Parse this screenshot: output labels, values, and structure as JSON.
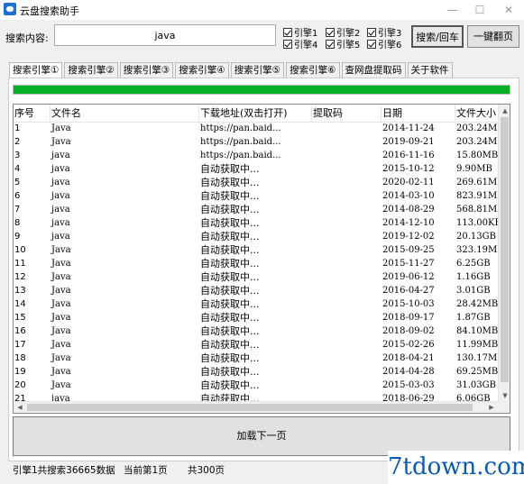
{
  "window": {
    "title": "云盘搜索助手"
  },
  "search": {
    "label": "搜索内容:",
    "value": "java"
  },
  "engines": [
    {
      "label": "引擎1",
      "checked": true
    },
    {
      "label": "引擎2",
      "checked": true
    },
    {
      "label": "引擎3",
      "checked": true
    },
    {
      "label": "引擎4",
      "checked": true
    },
    {
      "label": "引擎5",
      "checked": true
    },
    {
      "label": "引擎6",
      "checked": true
    }
  ],
  "buttons": {
    "search": "搜索/回车",
    "onekey": "一键翻页",
    "load_next": "加载下一页"
  },
  "tabs": [
    "搜索引擎①",
    "搜索引擎②",
    "搜索引擎③",
    "搜索引擎④",
    "搜索引擎⑤",
    "搜索引擎⑥",
    "查网盘提取码",
    "关于软件"
  ],
  "active_tab": 0,
  "progress": {
    "percent": 100,
    "color": "#06b025"
  },
  "table": {
    "columns": [
      "序号",
      "文件名",
      "下载地址(双击打开)",
      "提取码",
      "日期",
      "文件大小"
    ],
    "rows": [
      [
        "1",
        "Java",
        "https://pan.baid...",
        "",
        "2014-11-24",
        "203.24MB"
      ],
      [
        "2",
        "Java",
        "https://pan.baid...",
        "",
        "2019-09-21",
        "203.24MB"
      ],
      [
        "3",
        "java",
        "https://pan.baid...",
        "",
        "2016-11-16",
        "15.80MB"
      ],
      [
        "4",
        "java",
        "自动获取中...",
        "",
        "2015-10-12",
        "9.90MB"
      ],
      [
        "5",
        "java",
        "自动获取中...",
        "",
        "2020-02-11",
        "269.61MB"
      ],
      [
        "6",
        "java",
        "自动获取中...",
        "",
        "2014-03-10",
        "823.91MB"
      ],
      [
        "7",
        "java",
        "自动获取中...",
        "",
        "2014-08-29",
        "568.81MB"
      ],
      [
        "8",
        "java",
        "自动获取中...",
        "",
        "2014-12-10",
        "113.00KB"
      ],
      [
        "9",
        "java",
        "自动获取中...",
        "",
        "2019-12-02",
        "20.13GB"
      ],
      [
        "10",
        "Java",
        "自动获取中...",
        "",
        "2015-09-25",
        "323.19MB"
      ],
      [
        "11",
        "Java",
        "自动获取中...",
        "",
        "2015-11-27",
        "6.25GB"
      ],
      [
        "12",
        "Java",
        "自动获取中...",
        "",
        "2019-06-12",
        "1.16GB"
      ],
      [
        "13",
        "Java",
        "自动获取中...",
        "",
        "2016-04-27",
        "3.01GB"
      ],
      [
        "14",
        "Java",
        "自动获取中...",
        "",
        "2015-10-03",
        "28.42MB"
      ],
      [
        "15",
        "Java",
        "自动获取中...",
        "",
        "2018-09-17",
        "1.87GB"
      ],
      [
        "16",
        "Java",
        "自动获取中...",
        "",
        "2018-09-02",
        "84.10MB"
      ],
      [
        "17",
        "Java",
        "自动获取中...",
        "",
        "2015-02-26",
        "11.99MB"
      ],
      [
        "18",
        "Java",
        "自动获取中...",
        "",
        "2018-04-21",
        "130.17MB"
      ],
      [
        "19",
        "Java",
        "自动获取中...",
        "",
        "2014-04-28",
        "69.25MB"
      ],
      [
        "20",
        "Java",
        "自动获取中...",
        "",
        "2015-03-03",
        "31.03GB"
      ],
      [
        "21",
        "java",
        "自动获取中...",
        "",
        "2018-06-29",
        "6.06GB"
      ]
    ]
  },
  "status": {
    "engine_info": "引擎1共搜索36665数据",
    "page_current": "当前第1页",
    "page_total": "共300页"
  },
  "watermark": "7tdown.com"
}
